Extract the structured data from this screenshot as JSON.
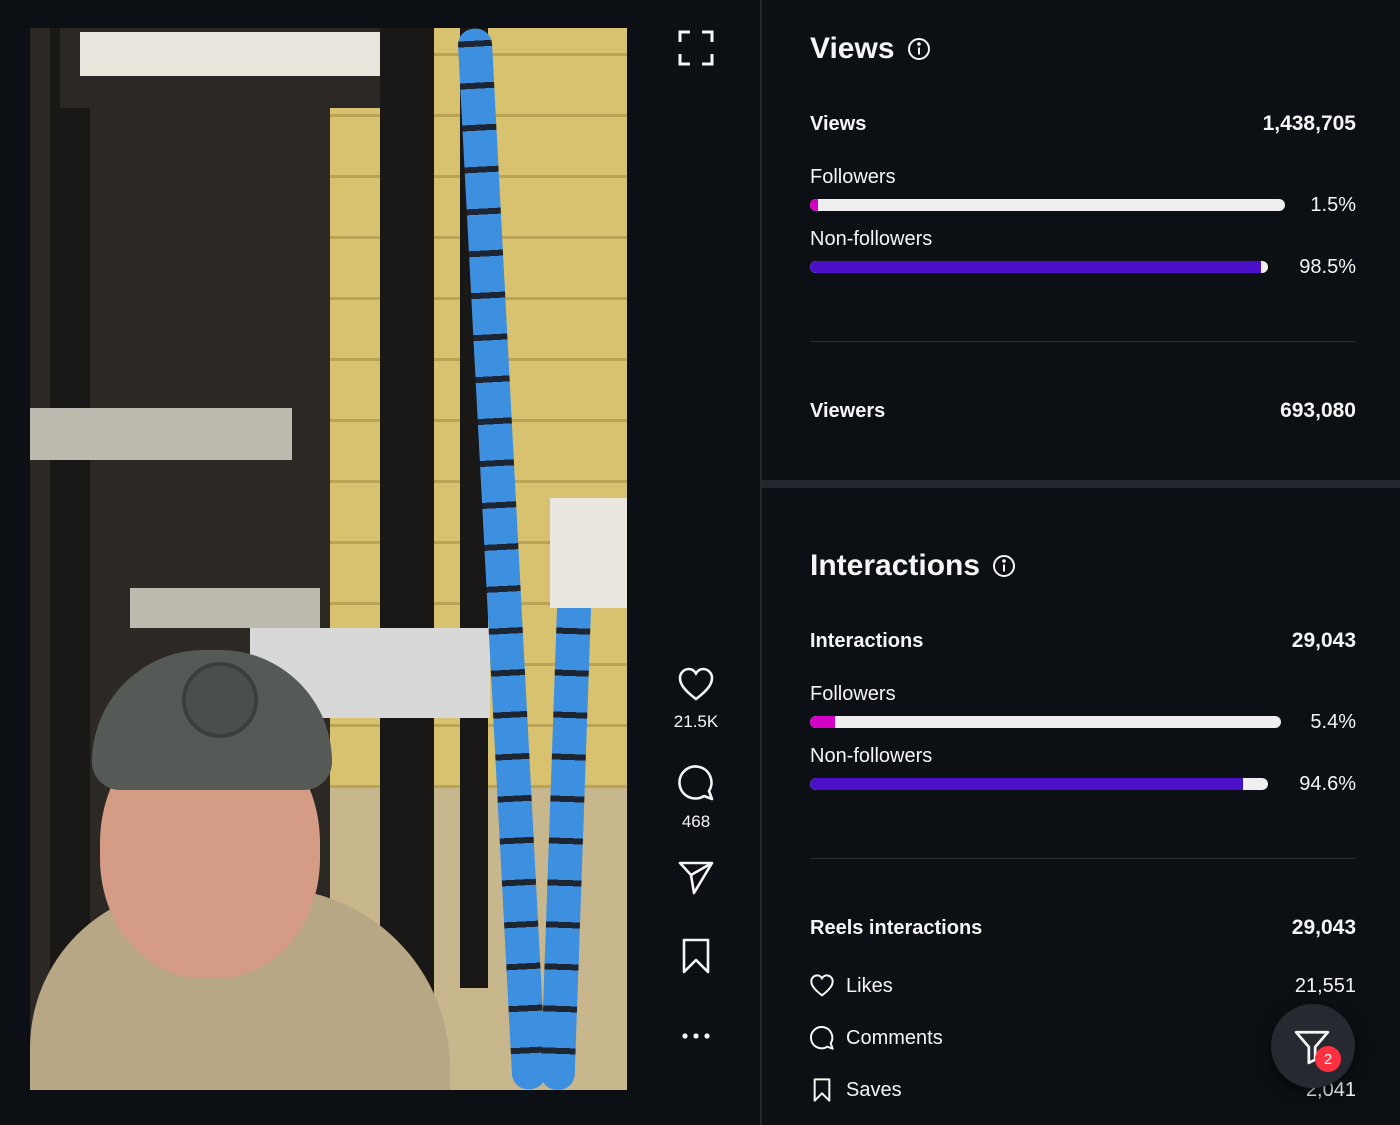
{
  "actions": {
    "likes_count": "21.5K",
    "comments_count": "468"
  },
  "views": {
    "title": "Views",
    "total_label": "Views",
    "total_value": "1,438,705",
    "followers_label": "Followers",
    "followers_pct": "1.5%",
    "followers_fraction": 0.015,
    "nonfollowers_label": "Non-followers",
    "nonfollowers_pct": "98.5%",
    "nonfollowers_fraction": 0.985,
    "viewers_label": "Viewers",
    "viewers_value": "693,080"
  },
  "interactions": {
    "title": "Interactions",
    "total_label": "Interactions",
    "total_value": "29,043",
    "followers_label": "Followers",
    "followers_pct": "5.4%",
    "followers_fraction": 0.054,
    "nonfollowers_label": "Non-followers",
    "nonfollowers_pct": "94.6%",
    "nonfollowers_fraction": 0.946,
    "reels_label": "Reels interactions",
    "reels_value": "29,043",
    "likes_label": "Likes",
    "likes_value": "21,551",
    "comments_label": "Comments",
    "saves_label": "Saves",
    "saves_value": "2,041"
  },
  "filter": {
    "badge": "2"
  },
  "colors": {
    "followers_bar": "#d300c5",
    "nonfollowers_bar": "#4a10c8",
    "track": "#efefef",
    "badge": "#ff3040"
  }
}
